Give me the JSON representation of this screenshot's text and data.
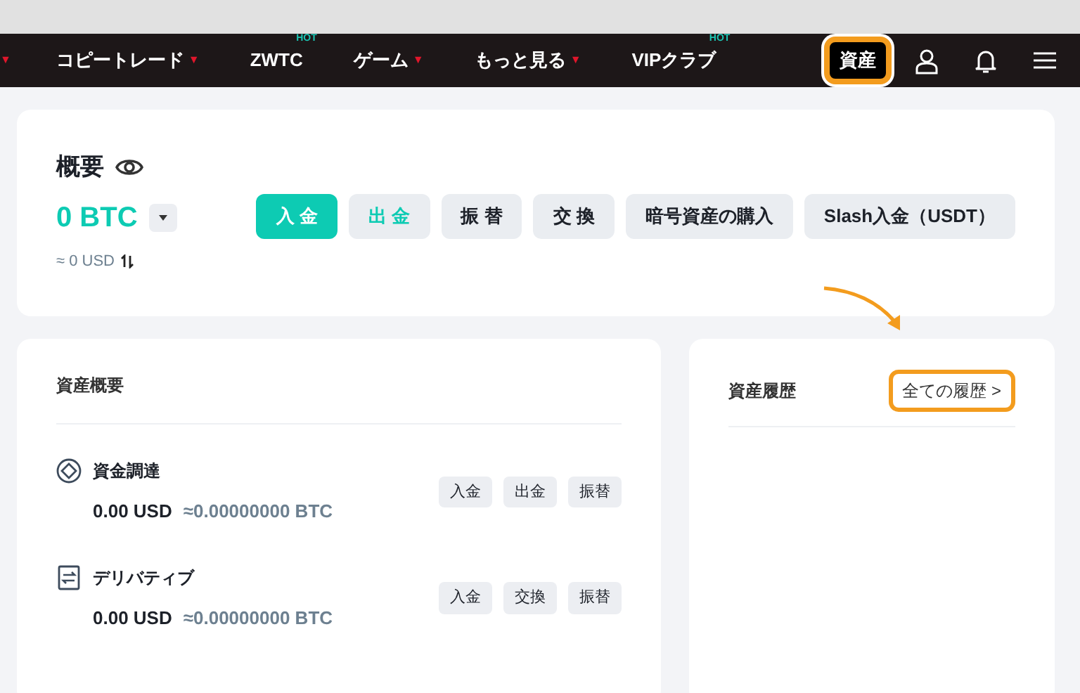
{
  "navbar": {
    "items": [
      {
        "caret": "▼"
      },
      {
        "label": "コピートレード",
        "caret": "▼"
      },
      {
        "label": "ZWTC",
        "badge": "HOT"
      },
      {
        "label": "ゲーム",
        "caret": "▼"
      },
      {
        "label": "もっと見る",
        "caret": "▼"
      },
      {
        "label": "VIPクラブ",
        "badge": "HOT"
      }
    ],
    "assets_button": {
      "label": "資産",
      "highlighted": true
    }
  },
  "overview": {
    "title": "概要",
    "balance": "0 BTC",
    "usd": "≈ 0 USD",
    "buttons": [
      {
        "label": "入 金",
        "kind": "primary"
      },
      {
        "label": "出 金",
        "kind": "accent"
      },
      {
        "label": "振 替",
        "kind": "plain"
      },
      {
        "label": "交 換",
        "kind": "plain"
      },
      {
        "label": "暗号資産の購入",
        "kind": "plain"
      },
      {
        "label": "Slash入金（USDT）",
        "kind": "plain"
      }
    ]
  },
  "asset_summary": {
    "title": "資産概要",
    "accounts": [
      {
        "name": "資金調達",
        "kind": "funding",
        "usd": "0.00 USD",
        "btc": "≈0.00000000 BTC",
        "actions": [
          "入金",
          "出金",
          "振替"
        ]
      },
      {
        "name": "デリバティブ",
        "kind": "derivatives",
        "usd": "0.00 USD",
        "btc": "≈0.00000000 BTC",
        "actions": [
          "入金",
          "交換",
          "振替"
        ]
      }
    ]
  },
  "asset_history": {
    "title": "資産履歴",
    "link": {
      "label": "全ての履歴 >",
      "highlighted": true
    }
  }
}
